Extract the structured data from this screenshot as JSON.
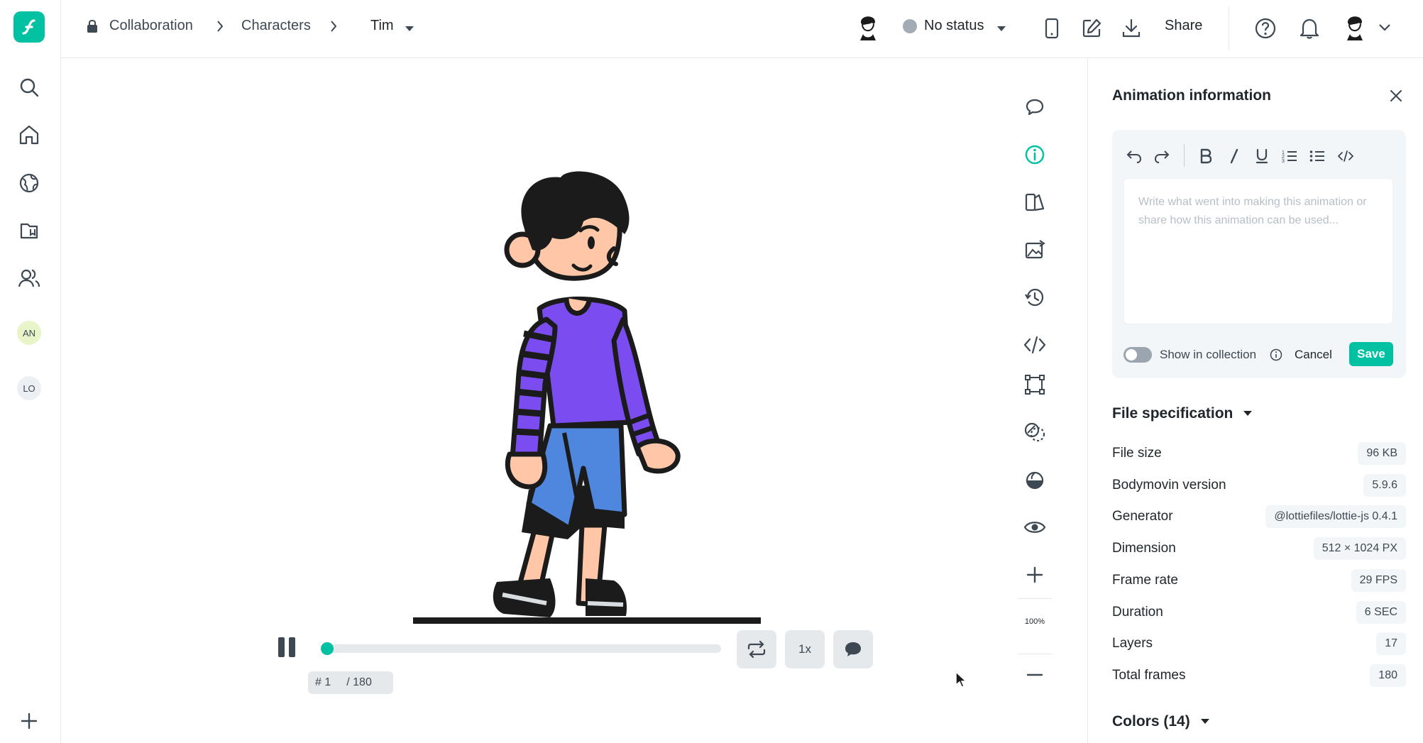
{
  "breadcrumb": {
    "workspace": "Collaboration",
    "folder": "Characters",
    "file": "Tim"
  },
  "status": {
    "label": "No status",
    "color": "#a3acb5"
  },
  "header": {
    "share_label": "Share"
  },
  "sidebar": {
    "badges": [
      {
        "label": "AN",
        "color": "#e8f5c8"
      },
      {
        "label": "LO",
        "color": "#eceff3"
      }
    ]
  },
  "player": {
    "frame_current": "# 1",
    "frame_total": "/ 180",
    "speed": "1x",
    "progress": 0.0
  },
  "zoom": {
    "level": "100%"
  },
  "panel": {
    "title": "Animation information",
    "editor_placeholder": "Write what went into making this animation or share how this animation can be used...",
    "show_in_collection": "Show in collection",
    "cancel": "Cancel",
    "save": "Save"
  },
  "spec": {
    "heading": "File specification",
    "rows": [
      {
        "label": "File size",
        "value": "96 KB"
      },
      {
        "label": "Bodymovin version",
        "value": "5.9.6"
      },
      {
        "label": "Generator",
        "value": "@lottiefiles/lottie-js 0.4.1"
      },
      {
        "label": "Dimension",
        "value": "512 × 1024 PX"
      },
      {
        "label": "Frame rate",
        "value": "29 FPS"
      },
      {
        "label": "Duration",
        "value": "6 SEC"
      },
      {
        "label": "Layers",
        "value": "17"
      },
      {
        "label": "Total frames",
        "value": "180"
      }
    ]
  },
  "colors": {
    "heading": "Colors (14)"
  },
  "theme": {
    "accent": "#00c1a2",
    "character_shirt": "#7b4cf0",
    "character_pants": "#4f86de",
    "skin": "#ffc7a8"
  }
}
